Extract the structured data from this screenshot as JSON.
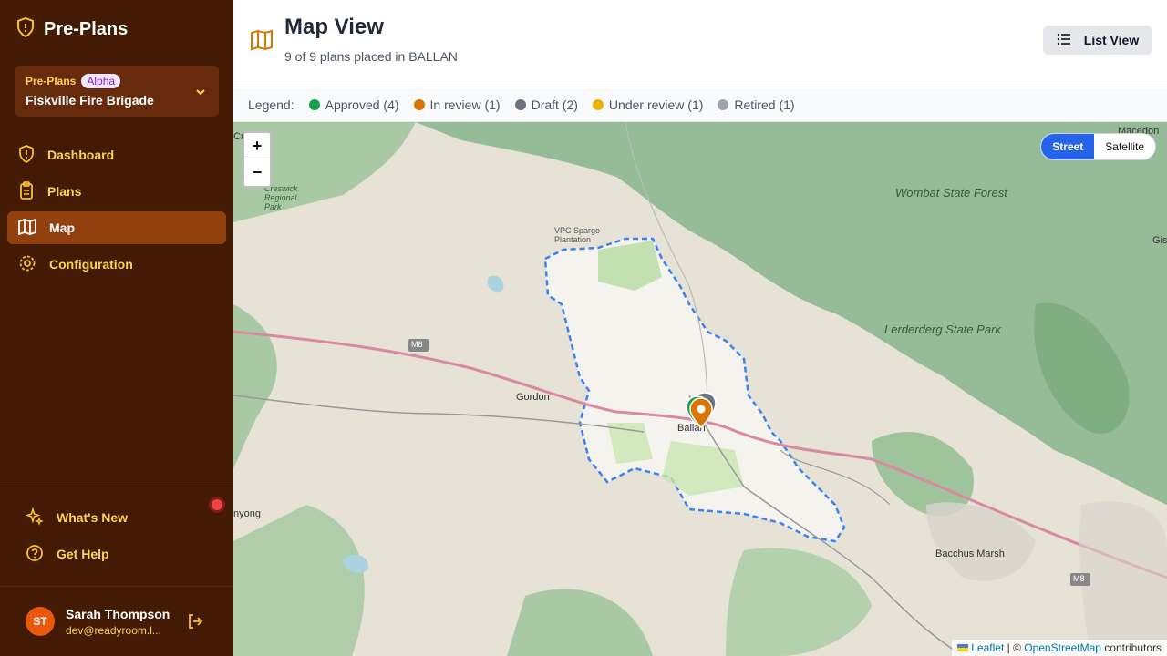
{
  "brand": {
    "title": "Pre-Plans"
  },
  "org": {
    "app": "Pre-Plans",
    "badge": "Alpha",
    "name": "Fiskville Fire Brigade"
  },
  "nav": [
    {
      "label": "Dashboard",
      "icon": "shield-icon"
    },
    {
      "label": "Plans",
      "icon": "clipboard-icon"
    },
    {
      "label": "Map",
      "icon": "map-icon",
      "active": true
    },
    {
      "label": "Configuration",
      "icon": "gear-icon"
    }
  ],
  "bottom_nav": [
    {
      "label": "What's New",
      "icon": "sparkles-icon"
    },
    {
      "label": "Get Help",
      "icon": "help-icon"
    }
  ],
  "user": {
    "initials": "ST",
    "name": "Sarah Thompson",
    "email": "dev@readyroom.l..."
  },
  "header": {
    "title": "Map View",
    "subtitle": "9 of 9 plans placed in BALLAN",
    "list_view": "List View"
  },
  "legend": {
    "label": "Legend:",
    "items": [
      {
        "label": "Approved (4)",
        "color": "#16a34a"
      },
      {
        "label": "In review (1)",
        "color": "#d97706"
      },
      {
        "label": "Draft (2)",
        "color": "#6b7280"
      },
      {
        "label": "Under review (1)",
        "color": "#eab308"
      },
      {
        "label": "Retired (1)",
        "color": "#9ca3af"
      }
    ]
  },
  "map": {
    "zoom_in": "+",
    "zoom_out": "−",
    "layers": {
      "street": "Street",
      "satellite": "Satellite"
    },
    "labels": {
      "wombat": "Wombat State Forest",
      "lerderderg": "Lerderderg State Park",
      "gordon": "Gordon",
      "ballan": "Ballan",
      "bacchus": "Bacchus Marsh",
      "plantation": "VPC Spargo Plantation",
      "creswick": "Creswick Regional Park",
      "m8": "M8",
      "m8_2": "M8",
      "macedon": "Macedon",
      "myong": "nyong",
      "gis": "Gis",
      "cre": "Cre"
    },
    "attribution": {
      "leaflet": "Leaflet",
      "sep": " | © ",
      "osm": "OpenStreetMap",
      "tail": " contributors"
    }
  }
}
